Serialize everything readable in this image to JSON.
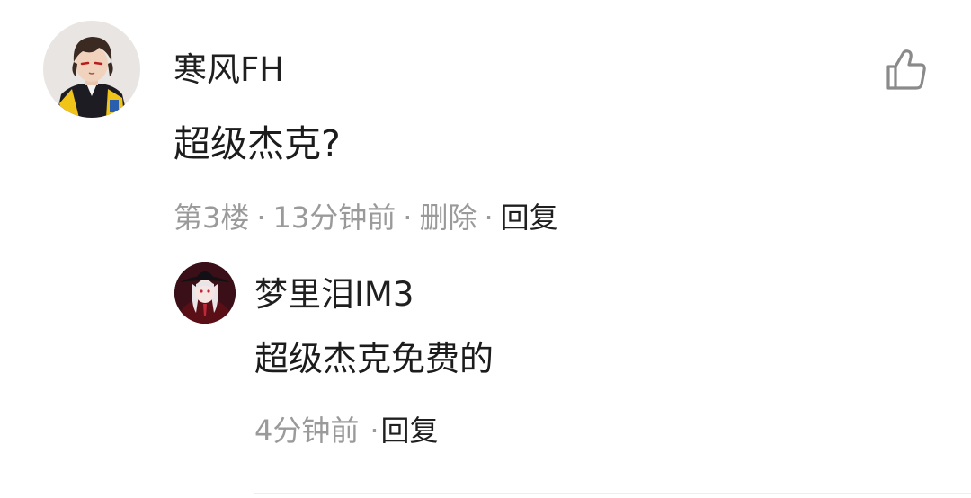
{
  "comment": {
    "username": "寒风FH",
    "content": "超级杰克?",
    "floor": "第3楼",
    "time": "13分钟前",
    "delete_label": "删除",
    "reply_label": "回复",
    "like_icon": "thumbs-up-icon"
  },
  "reply": {
    "username": "梦里泪IM3",
    "content": "超级杰克免费的",
    "time": "4分钟前",
    "reply_label": "回复"
  },
  "separator": "·",
  "colors": {
    "meta_gray": "#9a9a9a",
    "text_dark": "#1f1f1f",
    "icon_gray": "#8a8a8a"
  }
}
